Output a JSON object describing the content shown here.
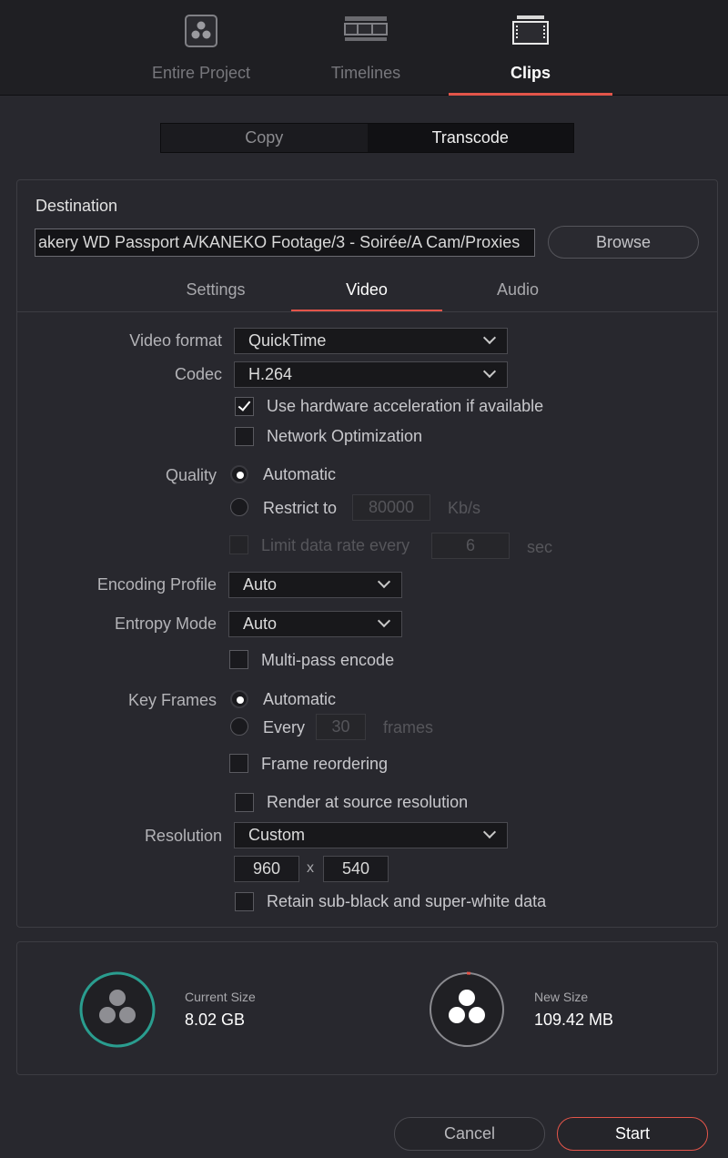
{
  "top_tabs": [
    {
      "label": "Entire Project",
      "icon": "resolve-logo-icon"
    },
    {
      "label": "Timelines",
      "icon": "timeline-icon"
    },
    {
      "label": "Clips",
      "icon": "clip-icon",
      "active": true
    }
  ],
  "mode": {
    "options": [
      "Copy",
      "Transcode"
    ],
    "selected": "Transcode"
  },
  "destination": {
    "title": "Destination",
    "path": "akery WD Passport A/KANEKO Footage/3 - Soirée/A Cam/Proxies",
    "browse_label": "Browse"
  },
  "sub_tabs": [
    {
      "label": "Settings"
    },
    {
      "label": "Video",
      "active": true
    },
    {
      "label": "Audio"
    }
  ],
  "video": {
    "format_label": "Video format",
    "format_value": "QuickTime",
    "codec_label": "Codec",
    "codec_value": "H.264",
    "hw_accel_label": "Use hardware acceleration if available",
    "hw_accel_checked": true,
    "network_opt_label": "Network Optimization",
    "network_opt_checked": false,
    "quality_label": "Quality",
    "quality_auto_label": "Automatic",
    "quality_restrict_label": "Restrict to",
    "quality_restrict_value": "80000",
    "quality_restrict_unit": "Kb/s",
    "limit_rate_label": "Limit data rate every",
    "limit_rate_value": "6",
    "limit_rate_unit": "sec",
    "encoding_profile_label": "Encoding Profile",
    "encoding_profile_value": "Auto",
    "entropy_mode_label": "Entropy Mode",
    "entropy_mode_value": "Auto",
    "multipass_label": "Multi-pass encode",
    "keyframes_label": "Key Frames",
    "keyframes_auto_label": "Automatic",
    "keyframes_every_label": "Every",
    "keyframes_every_value": "30",
    "keyframes_every_unit": "frames",
    "frame_reorder_label": "Frame reordering",
    "render_source_label": "Render at source resolution",
    "resolution_label": "Resolution",
    "resolution_value": "Custom",
    "res_width": "960",
    "res_x": "x",
    "res_height": "540",
    "retain_label": "Retain sub-black and super-white data"
  },
  "summary": {
    "current_label": "Current Size",
    "current_value": "8.02 GB",
    "new_label": "New Size",
    "new_value": "109.42 MB"
  },
  "footer": {
    "cancel_label": "Cancel",
    "start_label": "Start"
  },
  "colors": {
    "accent": "#e3554a",
    "teal": "#2a9d8f",
    "background": "#28282e"
  }
}
